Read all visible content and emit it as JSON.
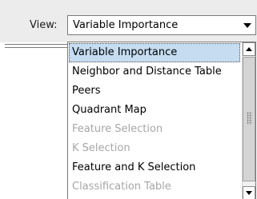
{
  "view_label": "View:",
  "view_select": {
    "selected_value": "Variable Importance"
  },
  "dropdown": {
    "options": [
      {
        "label": "Variable Importance",
        "state": "selected"
      },
      {
        "label": "Neighbor and Distance Table",
        "state": "enabled"
      },
      {
        "label": "Peers",
        "state": "enabled"
      },
      {
        "label": "Quadrant Map",
        "state": "enabled"
      },
      {
        "label": "Feature Selection",
        "state": "disabled"
      },
      {
        "label": "K Selection",
        "state": "disabled"
      },
      {
        "label": "Feature and K Selection",
        "state": "enabled"
      },
      {
        "label": "Classification Table",
        "state": "disabled"
      }
    ]
  },
  "colors": {
    "selected_highlight": "#c5dcf1",
    "disabled_text": "#a6a6a6",
    "toolbar_bg": "#ececec"
  },
  "icons": {
    "combo_arrow": "chevron-down-icon",
    "scroll_up": "scroll-up-arrow-icon",
    "scroll_down": "scroll-down-arrow-icon"
  }
}
